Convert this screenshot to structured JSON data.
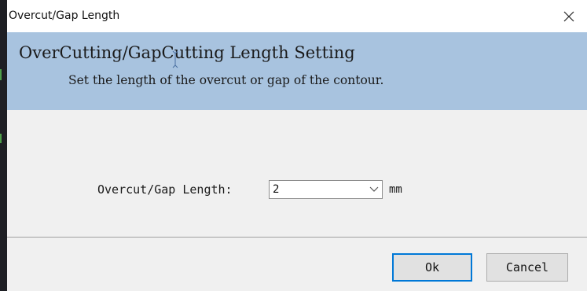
{
  "window": {
    "title": "Overcut/Gap Length",
    "close_glyph": "✕"
  },
  "header": {
    "title": "OverCutting/GapCutting Length Setting",
    "subtitle": "Set the length of the overcut or gap of the contour."
  },
  "form": {
    "length_label": "Overcut/Gap Length:",
    "length_value": "2",
    "unit": "mm"
  },
  "buttons": {
    "ok_label": "Ok",
    "cancel_label": "Cancel"
  },
  "icons": {
    "close": "close-icon",
    "dropdown": "chevron-down-icon",
    "cursor": "text-cursor-icon"
  },
  "colors": {
    "header_band": "#a8c3df",
    "default_button_border": "#0078d7"
  }
}
